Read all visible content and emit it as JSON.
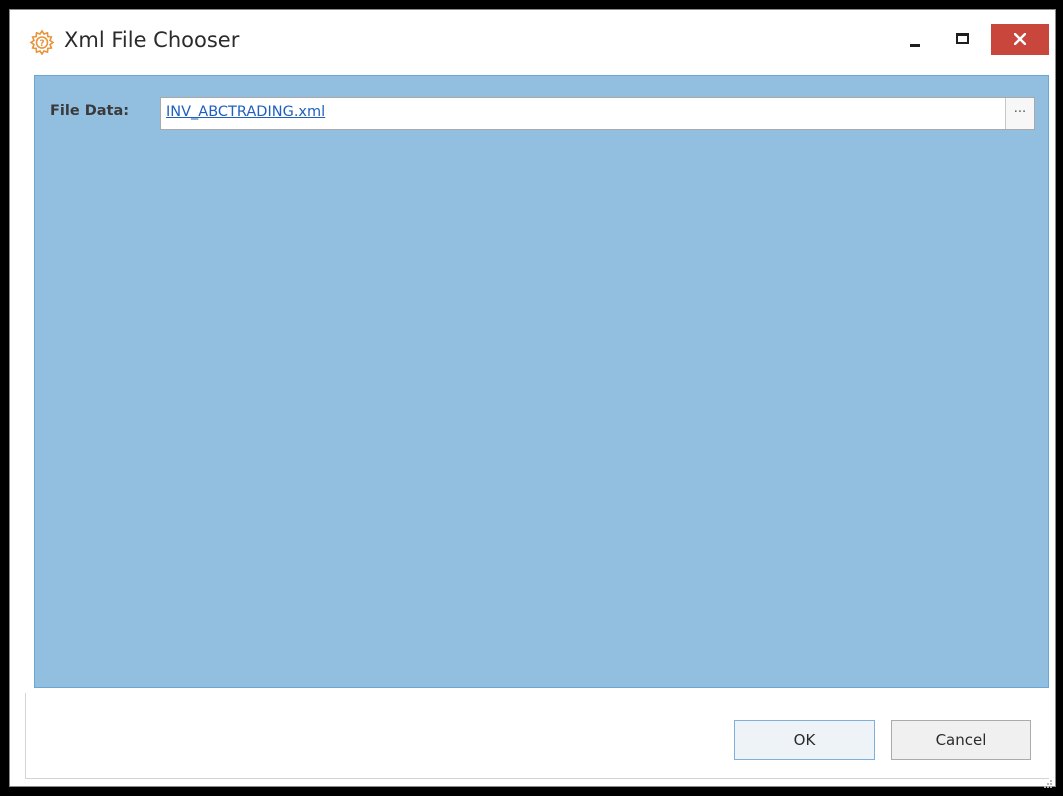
{
  "window": {
    "title": "Xml File Chooser",
    "icon": "gear-question-icon",
    "controls": {
      "minimize": "minimize-icon",
      "maximize": "maximize-icon",
      "close": "close-icon"
    }
  },
  "form": {
    "file_data_label": "File Data:",
    "file_data_value": "INV_ABCTRADING.xml",
    "browse_label": "···"
  },
  "buttons": {
    "ok_label": "OK",
    "cancel_label": "Cancel"
  },
  "colors": {
    "panel_background": "#92bfe0",
    "close_button": "#c9463d",
    "link": "#1f5fbf",
    "app_icon": "#e8943a"
  }
}
